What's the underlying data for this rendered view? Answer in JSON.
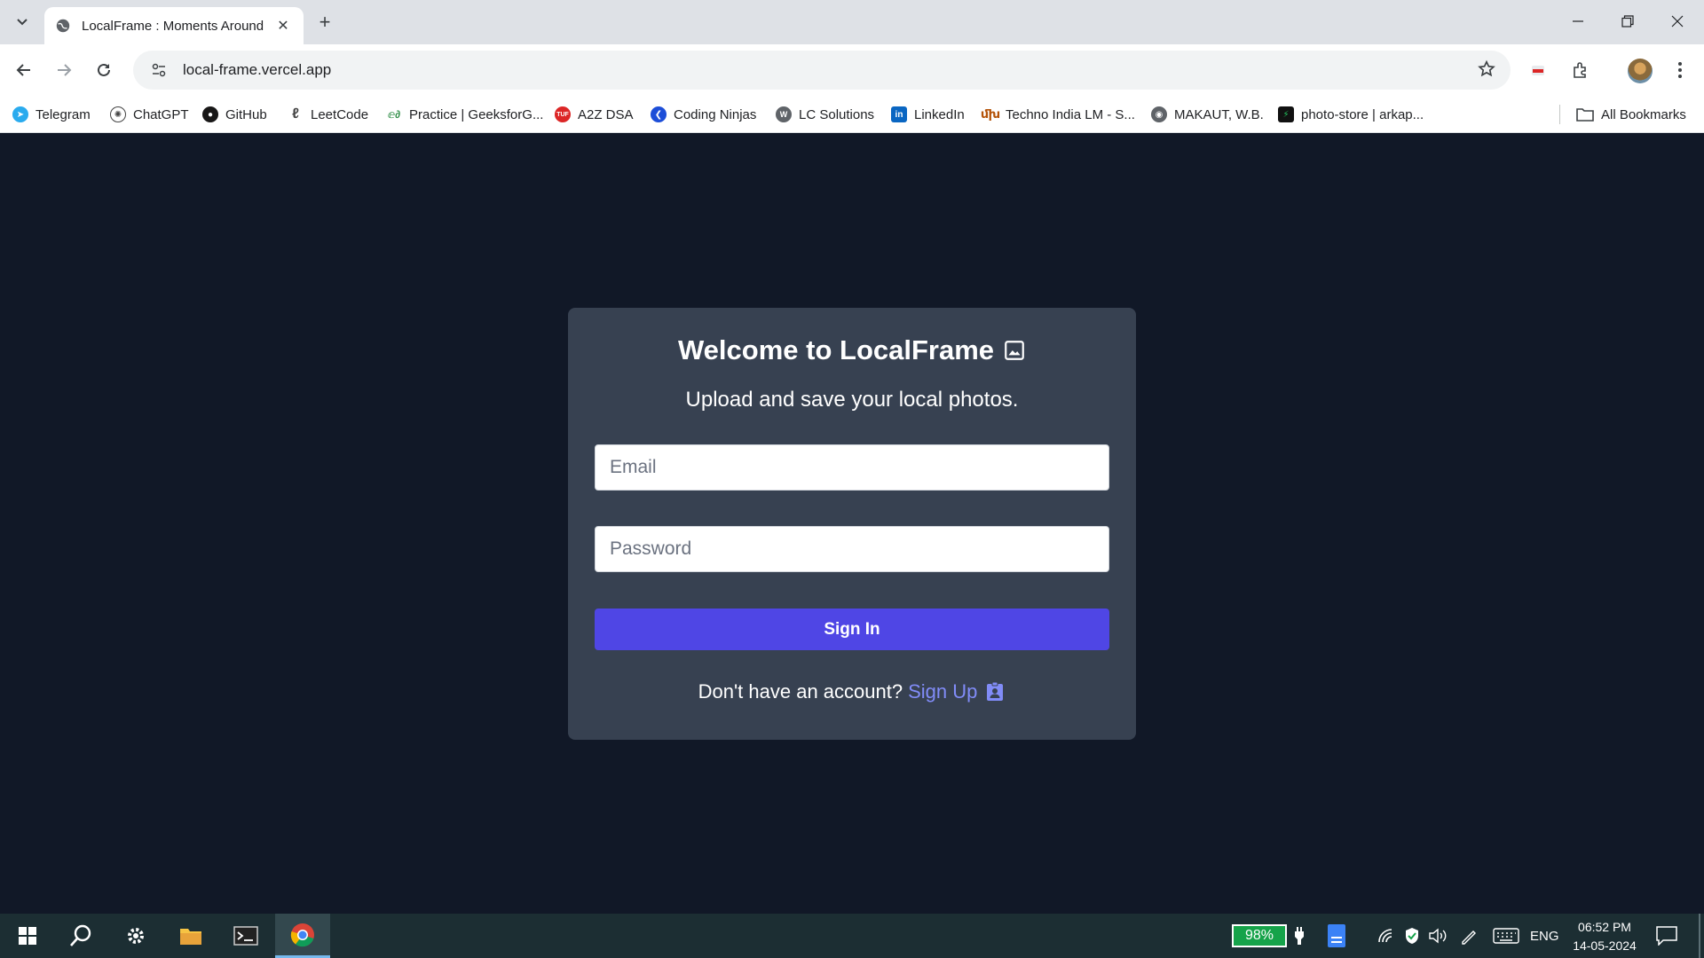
{
  "browser": {
    "tab_title": "LocalFrame : Moments Around",
    "url": "local-frame.vercel.app",
    "bookmarks": [
      {
        "label": "Telegram",
        "icon": "telegram-icon",
        "color": "#2aabee"
      },
      {
        "label": "ChatGPT",
        "icon": "chatgpt-icon",
        "color": "#444444"
      },
      {
        "label": "GitHub",
        "icon": "github-icon",
        "color": "#181717"
      },
      {
        "label": "LeetCode",
        "icon": "leetcode-icon",
        "color": "#444444"
      },
      {
        "label": "Practice | GeeksforG...",
        "icon": "geeksforgeeks-icon",
        "color": "#2f8d46"
      },
      {
        "label": "A2Z DSA",
        "icon": "tuf-icon",
        "color": "#dc2626"
      },
      {
        "label": "Coding Ninjas",
        "icon": "coding-ninjas-icon",
        "color": "#1d4ed8"
      },
      {
        "label": "LC Solutions",
        "icon": "lc-solutions-icon",
        "color": "#5f6368"
      },
      {
        "label": "LinkedIn",
        "icon": "linkedin-icon",
        "color": "#0a66c2"
      },
      {
        "label": "Techno India LM - S...",
        "icon": "techno-india-icon",
        "color": "#b45309"
      },
      {
        "label": "MAKAUT, W.B.",
        "icon": "globe-icon",
        "color": "#5f6368"
      },
      {
        "label": "photo-store | arkap...",
        "icon": "photo-store-icon",
        "color": "#111111"
      }
    ],
    "all_bookmarks_label": "All Bookmarks"
  },
  "login": {
    "title": "Welcome to LocalFrame",
    "subtitle": "Upload and save your local photos.",
    "email_placeholder": "Email",
    "password_placeholder": "Password",
    "signin_label": "Sign In",
    "no_account_text": "Don't have an account?",
    "signup_label": "Sign Up",
    "colors": {
      "page_bg": "#111827",
      "card_bg": "#374151",
      "button": "#4f46e5",
      "link": "#818cf8"
    }
  },
  "taskbar": {
    "battery": "98%",
    "language": "ENG",
    "time": "06:52 PM",
    "date": "14-05-2024"
  }
}
